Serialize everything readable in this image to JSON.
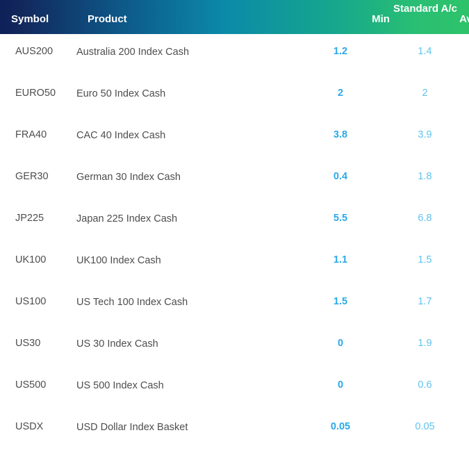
{
  "header": {
    "symbol_label": "Symbol",
    "product_label": "Product",
    "group_label": "Standard A/c",
    "min_label": "Min",
    "avg_label": "Avg",
    "gradient_start": "#12275c",
    "gradient_mid": "#0b8aa8",
    "gradient_end": "#2ec36a"
  },
  "colors": {
    "symbol_text": "#4d4d4d",
    "product_text": "#4d4d4d",
    "min_value": "#2aa9e8",
    "avg_value": "#5ec3ee",
    "background": "#ffffff"
  },
  "rows": [
    {
      "symbol": "AUS200",
      "product": "Australia 200 Index Cash",
      "min": "1.2",
      "avg": "1.4"
    },
    {
      "symbol": "EURO50",
      "product": "Euro 50 Index Cash",
      "min": "2",
      "avg": "2"
    },
    {
      "symbol": "FRA40",
      "product": "CAC 40 Index Cash",
      "min": "3.8",
      "avg": "3.9"
    },
    {
      "symbol": "GER30",
      "product": "German 30 Index Cash",
      "min": "0.4",
      "avg": "1.8"
    },
    {
      "symbol": "JP225",
      "product": "Japan 225 Index Cash",
      "min": "5.5",
      "avg": "6.8"
    },
    {
      "symbol": "UK100",
      "product": "UK100 Index Cash",
      "min": "1.1",
      "avg": "1.5"
    },
    {
      "symbol": "US100",
      "product": "US Tech 100 Index Cash",
      "min": "1.5",
      "avg": "1.7"
    },
    {
      "symbol": "US30",
      "product": "US 30 Index Cash",
      "min": "0",
      "avg": "1.9"
    },
    {
      "symbol": "US500",
      "product": "US 500 Index Cash",
      "min": "0",
      "avg": "0.6"
    },
    {
      "symbol": "USDX",
      "product": "USD Dollar Index Basket",
      "min": "0.05",
      "avg": "0.05"
    }
  ]
}
